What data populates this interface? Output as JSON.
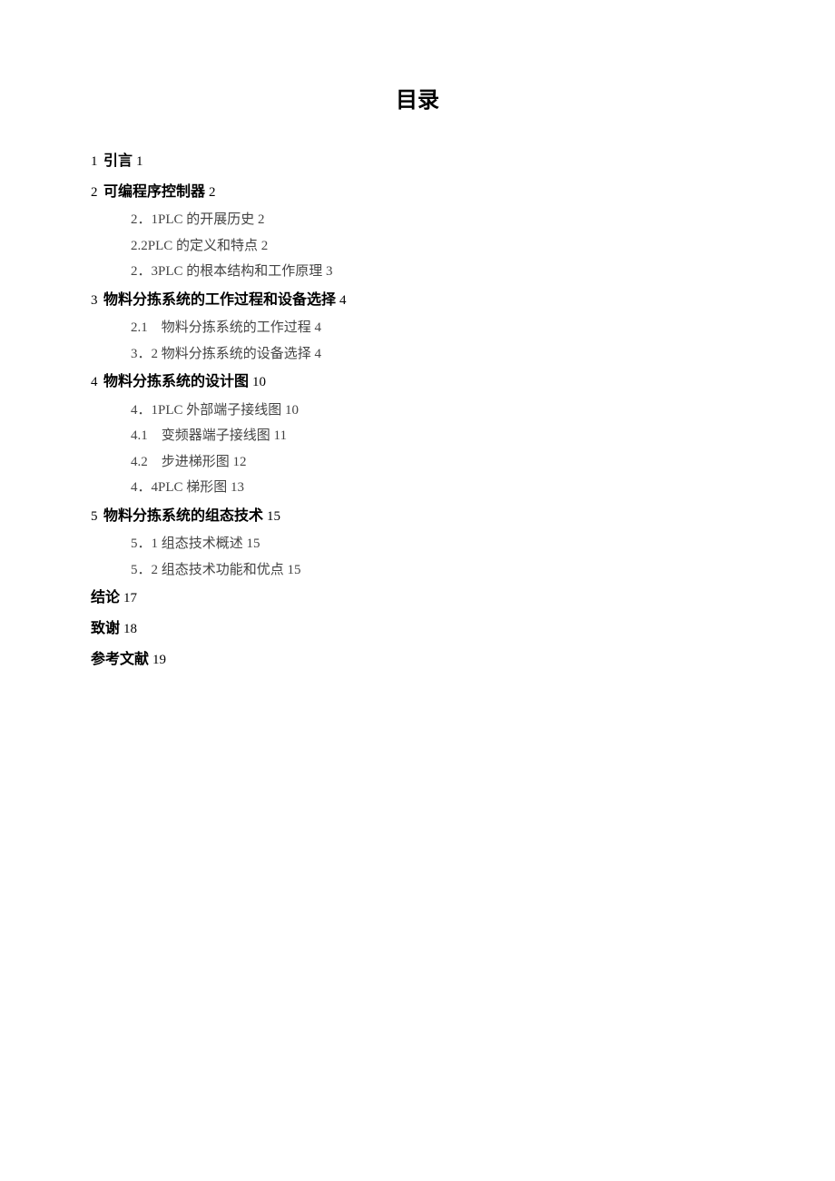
{
  "title": "目录",
  "entries": [
    {
      "kind": "section",
      "num": "1",
      "label": "引言",
      "page": "1"
    },
    {
      "kind": "section",
      "num": "2",
      "label": "可编程序控制器",
      "page": "2"
    },
    {
      "kind": "sub",
      "text": "2．1PLC 的开展历史 2"
    },
    {
      "kind": "sub",
      "text": "2.2PLC 的定义和特点 2"
    },
    {
      "kind": "sub",
      "text": "2．3PLC 的根本结构和工作原理 3"
    },
    {
      "kind": "section",
      "num": "3",
      "label": "物料分拣系统的工作过程和设备选择",
      "page": "4"
    },
    {
      "kind": "sub",
      "text": "2.1　物料分拣系统的工作过程 4"
    },
    {
      "kind": "sub",
      "text": "3．2 物料分拣系统的设备选择 4"
    },
    {
      "kind": "section",
      "num": "4",
      "label": "物料分拣系统的设计图",
      "page": "10"
    },
    {
      "kind": "sub",
      "text": "4．1PLC 外部端子接线图 10"
    },
    {
      "kind": "sub",
      "text": "4.1　变频器端子接线图 11"
    },
    {
      "kind": "sub",
      "text": "4.2　步进梯形图 12"
    },
    {
      "kind": "sub",
      "text": "4．4PLC 梯形图 13"
    },
    {
      "kind": "section",
      "num": "5",
      "label": "物料分拣系统的组态技术",
      "page": "15"
    },
    {
      "kind": "sub",
      "text": "5．1 组态技术概述 15"
    },
    {
      "kind": "sub",
      "text": "5．2 组态技术功能和优点 15"
    },
    {
      "kind": "section",
      "num": "",
      "label": "结论",
      "page": "17"
    },
    {
      "kind": "section",
      "num": "",
      "label": "致谢",
      "page": "18"
    },
    {
      "kind": "section",
      "num": "",
      "label": "参考文献",
      "page": "19"
    }
  ]
}
